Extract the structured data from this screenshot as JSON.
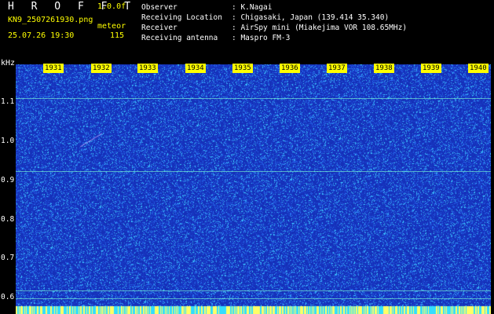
{
  "header": {
    "title": "H R O F F T",
    "version": "1.0.0f",
    "filename": "KN9_2507261930.png",
    "meteor_label": "meteor",
    "datetime": "25.07.26 19:30",
    "meteor_count": "115"
  },
  "info": [
    {
      "key": "Observer",
      "value": ": K.Nagai"
    },
    {
      "key": "Receiving Location",
      "value": ": Chigasaki, Japan (139.414 35.340)"
    },
    {
      "key": "Receiver",
      "value": ": AirSpy mini (Miakejima VOR 108.65MHz)"
    },
    {
      "key": "Receiving antenna",
      "value": ": Maspro FM-3"
    }
  ],
  "plot": {
    "unit": "kHz",
    "time_labels": [
      "1931",
      "1932",
      "1933",
      "1934",
      "1935",
      "1936",
      "1937",
      "1938",
      "1939",
      "1940"
    ],
    "y_labels": [
      "1.1",
      "1.0",
      "0.9",
      "0.8",
      "0.7",
      "0.6"
    ],
    "colors": {
      "background": "#1530b8",
      "noise": "#3a7dff",
      "hot": "#7fffd4",
      "label_bg": "#ffff00"
    }
  }
}
